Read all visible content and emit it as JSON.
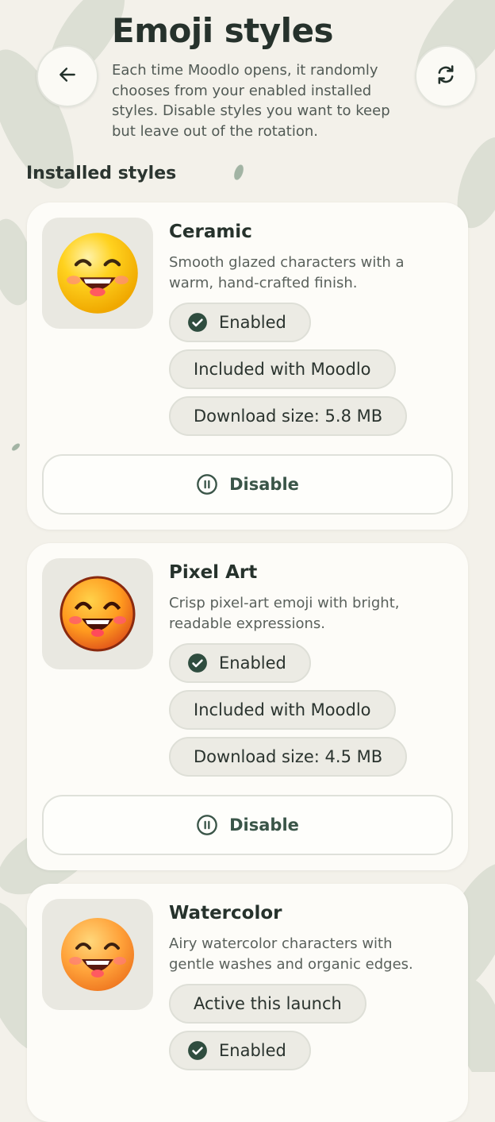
{
  "header": {
    "title": "Emoji styles",
    "subtitle": "Each time Moodlo opens, it randomly chooses from your enabled installed styles. Disable styles you want to keep but leave out of the rotation.",
    "back_icon": "arrow-left-icon",
    "refresh_icon": "refresh-icon"
  },
  "section": {
    "label": "Installed styles"
  },
  "colors": {
    "check_fill": "#2f4d3f",
    "accent_text": "#3a5548",
    "background": "#f3f1ea"
  },
  "styles": [
    {
      "name": "Ceramic",
      "description": "Smooth glazed characters with a warm, hand-crafted finish.",
      "chips": {
        "enabled": "Enabled",
        "included": "Included with Moodlo",
        "size": "Download size: 5.8 MB"
      },
      "action": "Disable"
    },
    {
      "name": "Pixel Art",
      "description": "Crisp pixel-art emoji with bright, readable expressions.",
      "chips": {
        "enabled": "Enabled",
        "included": "Included with Moodlo",
        "size": "Download size: 4.5 MB"
      },
      "action": "Disable"
    },
    {
      "name": "Watercolor",
      "description": "Airy watercolor characters with gentle washes and organic edges.",
      "chips": {
        "active": "Active this launch",
        "enabled": "Enabled"
      }
    }
  ]
}
